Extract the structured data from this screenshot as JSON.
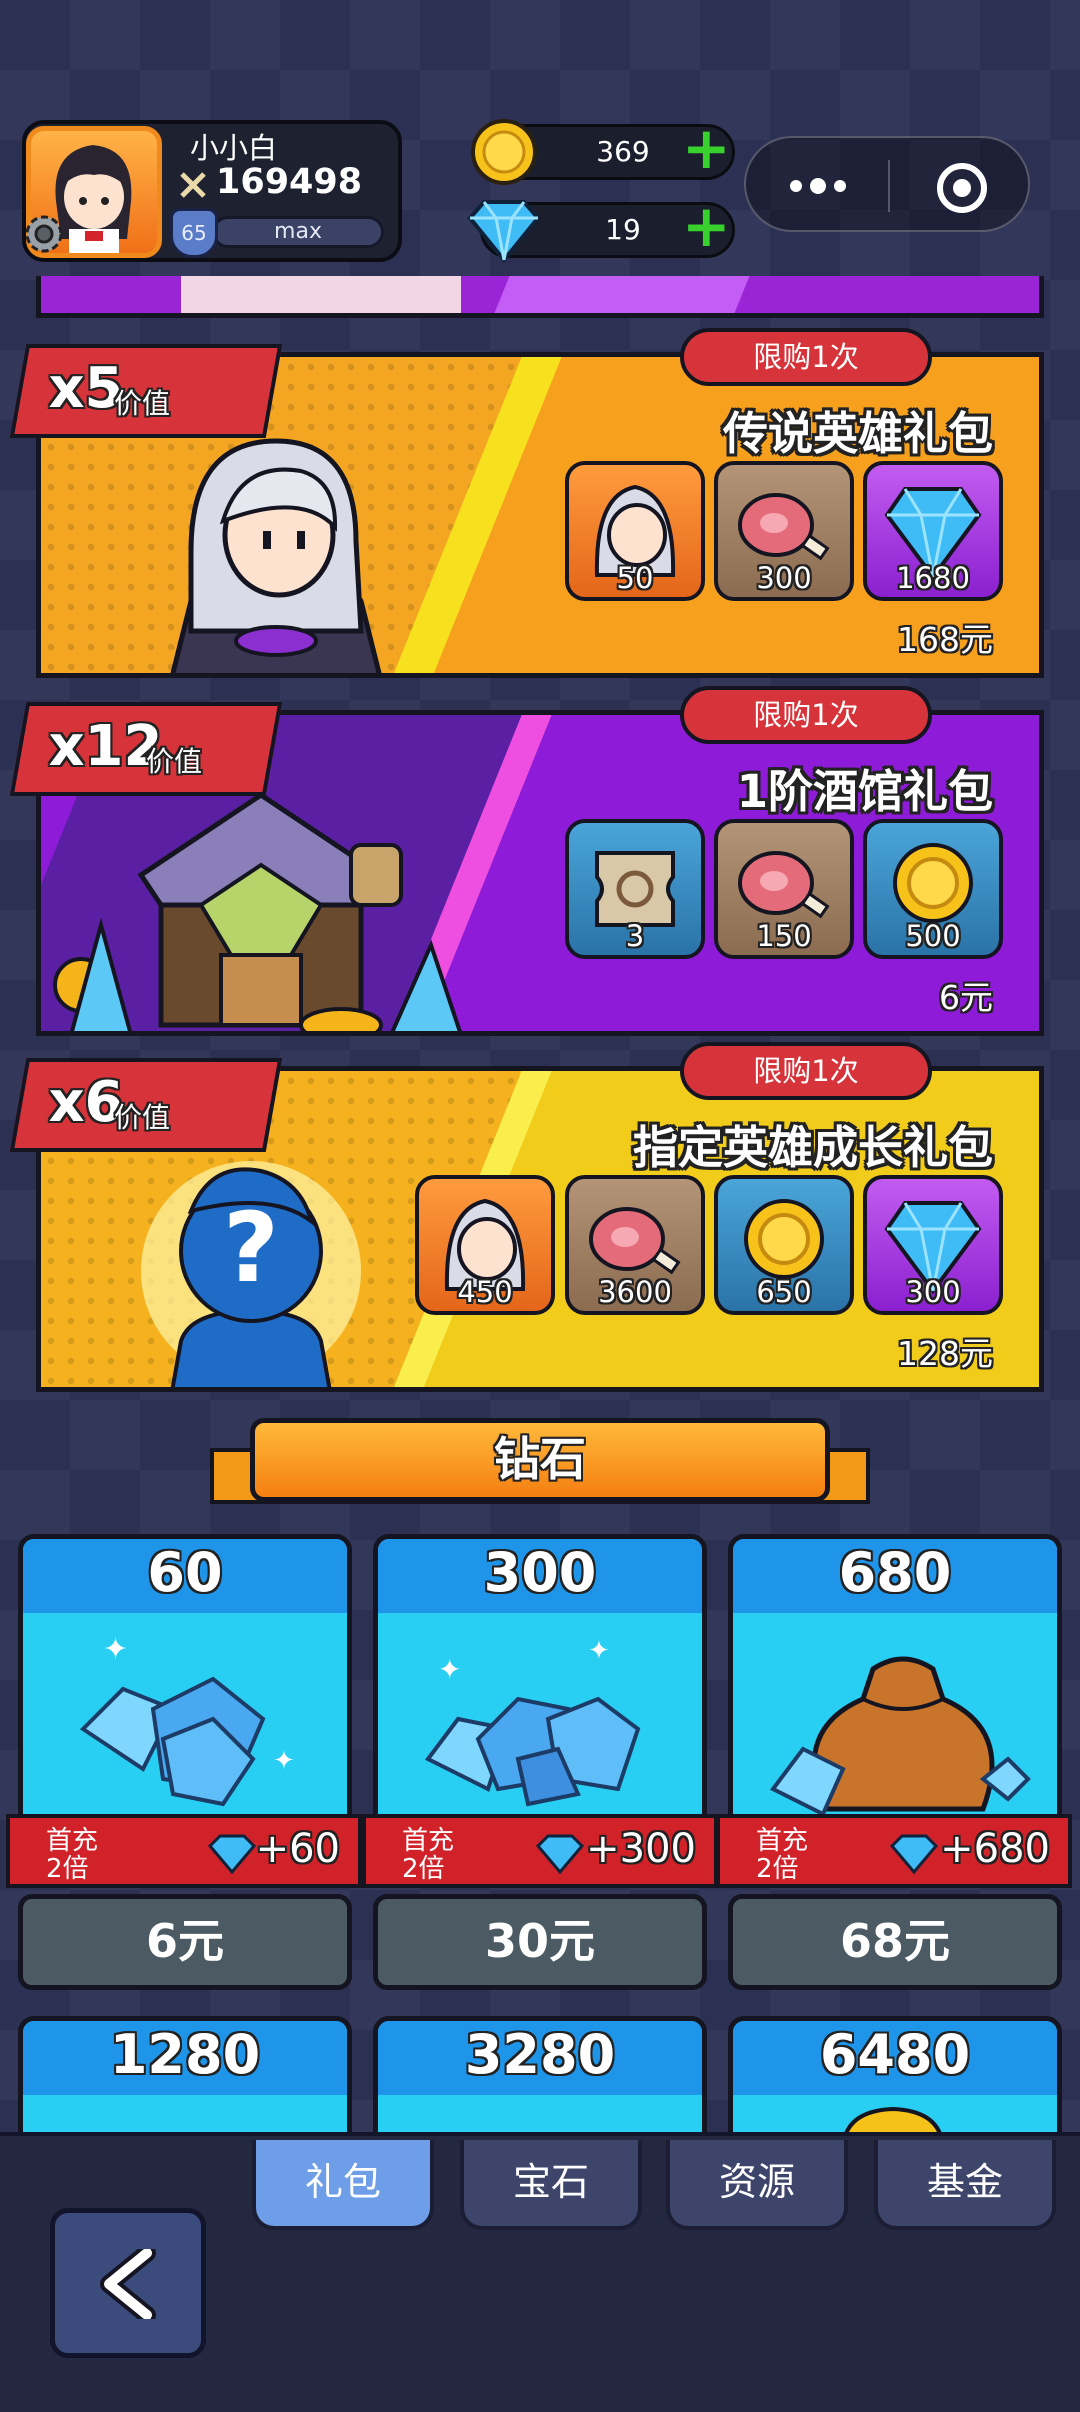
{
  "header": {
    "player_name": "小小白",
    "power": "169498",
    "level": "65",
    "level_status": "max",
    "gold": "369",
    "diamonds": "19"
  },
  "packs": [
    {
      "multiplier": "x5",
      "value_label": "价值",
      "limit": "限购1次",
      "title": "传说英雄礼包",
      "items": [
        {
          "icon": "hero-icon",
          "amount": "50"
        },
        {
          "icon": "meat-icon",
          "amount": "300"
        },
        {
          "icon": "diamond-icon",
          "amount": "1680"
        }
      ],
      "price": "168元"
    },
    {
      "multiplier": "x12",
      "value_label": "价值",
      "limit": "限购1次",
      "title": "1阶酒馆礼包",
      "items": [
        {
          "icon": "ticket-icon",
          "amount": "3"
        },
        {
          "icon": "meat-icon",
          "amount": "150"
        },
        {
          "icon": "gold-coin-icon",
          "amount": "500"
        }
      ],
      "price": "6元"
    },
    {
      "multiplier": "x6",
      "value_label": "价值",
      "limit": "限购1次",
      "title": "指定英雄成长礼包",
      "items": [
        {
          "icon": "hero-icon",
          "amount": "450"
        },
        {
          "icon": "meat-icon",
          "amount": "3600"
        },
        {
          "icon": "gold-coin-icon",
          "amount": "650"
        },
        {
          "icon": "diamond-icon",
          "amount": "300"
        }
      ],
      "price": "128元"
    }
  ],
  "diamond_section": {
    "title": "钻石",
    "cards": [
      {
        "amount": "60",
        "bonus_line1": "首充",
        "bonus_line2": "2倍",
        "bonus": "+60",
        "price": "6元"
      },
      {
        "amount": "300",
        "bonus_line1": "首充",
        "bonus_line2": "2倍",
        "bonus": "+300",
        "price": "30元"
      },
      {
        "amount": "680",
        "bonus_line1": "首充",
        "bonus_line2": "2倍",
        "bonus": "+680",
        "price": "68元"
      }
    ],
    "more_cards": [
      {
        "amount": "1280"
      },
      {
        "amount": "3280"
      },
      {
        "amount": "6480"
      }
    ]
  },
  "tabs": [
    {
      "label": "礼包",
      "active": true
    },
    {
      "label": "宝石",
      "active": false
    },
    {
      "label": "资源",
      "active": false
    },
    {
      "label": "基金",
      "active": false
    }
  ],
  "colors": {
    "background": "#2c3154",
    "tag_red": "#d6343a",
    "plus_green": "#39d12e",
    "active_tab": "#6f9ee8"
  }
}
